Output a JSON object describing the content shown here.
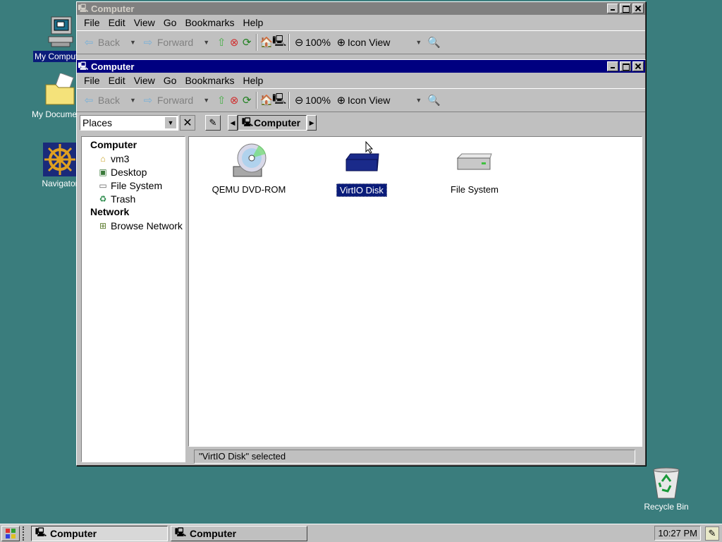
{
  "desktop": {
    "icons": [
      {
        "label": "My Computer",
        "name": "my-computer"
      },
      {
        "label": "My Documents",
        "name": "my-documents"
      },
      {
        "label": "Navigator",
        "name": "navigator"
      },
      {
        "label": "Recycle Bin",
        "name": "recycle-bin"
      }
    ],
    "background_color": "#3a7d7d"
  },
  "back_window": {
    "title": "Computer",
    "menu": [
      "File",
      "Edit",
      "View",
      "Go",
      "Bookmarks",
      "Help"
    ],
    "toolbar": {
      "back": "Back",
      "forward": "Forward",
      "zoom": "100%",
      "view_mode": "Icon View"
    }
  },
  "front_window": {
    "title": "Computer",
    "menu": [
      "File",
      "Edit",
      "View",
      "Go",
      "Bookmarks",
      "Help"
    ],
    "toolbar": {
      "back": "Back",
      "forward": "Forward",
      "zoom": "100%",
      "view_mode": "Icon View"
    },
    "places_combo": "Places",
    "path_button": "Computer",
    "sidebar": {
      "sections": [
        {
          "heading": "Computer",
          "items": [
            {
              "label": "vm3",
              "icon": "home-folder-icon"
            },
            {
              "label": "Desktop",
              "icon": "desktop-icon"
            },
            {
              "label": "File System",
              "icon": "drive-icon"
            },
            {
              "label": "Trash",
              "icon": "trash-icon"
            }
          ]
        },
        {
          "heading": "Network",
          "items": [
            {
              "label": "Browse Network",
              "icon": "network-icon"
            }
          ]
        }
      ]
    },
    "files": [
      {
        "label": "QEMU DVD-ROM",
        "icon": "dvd-drive-icon",
        "selected": false
      },
      {
        "label": "VirtIO Disk",
        "icon": "disk-drive-icon",
        "selected": true
      },
      {
        "label": "File System",
        "icon": "hard-drive-icon",
        "selected": false
      }
    ],
    "status": "\"VirtIO Disk\" selected"
  },
  "taskbar": {
    "tasks": [
      "Computer",
      "Computer"
    ],
    "clock": "10:27 PM"
  },
  "colors": {
    "title_active": "#000080",
    "title_inactive": "#808080",
    "selection": "#0a1c7a",
    "face": "#c0c0c0"
  }
}
